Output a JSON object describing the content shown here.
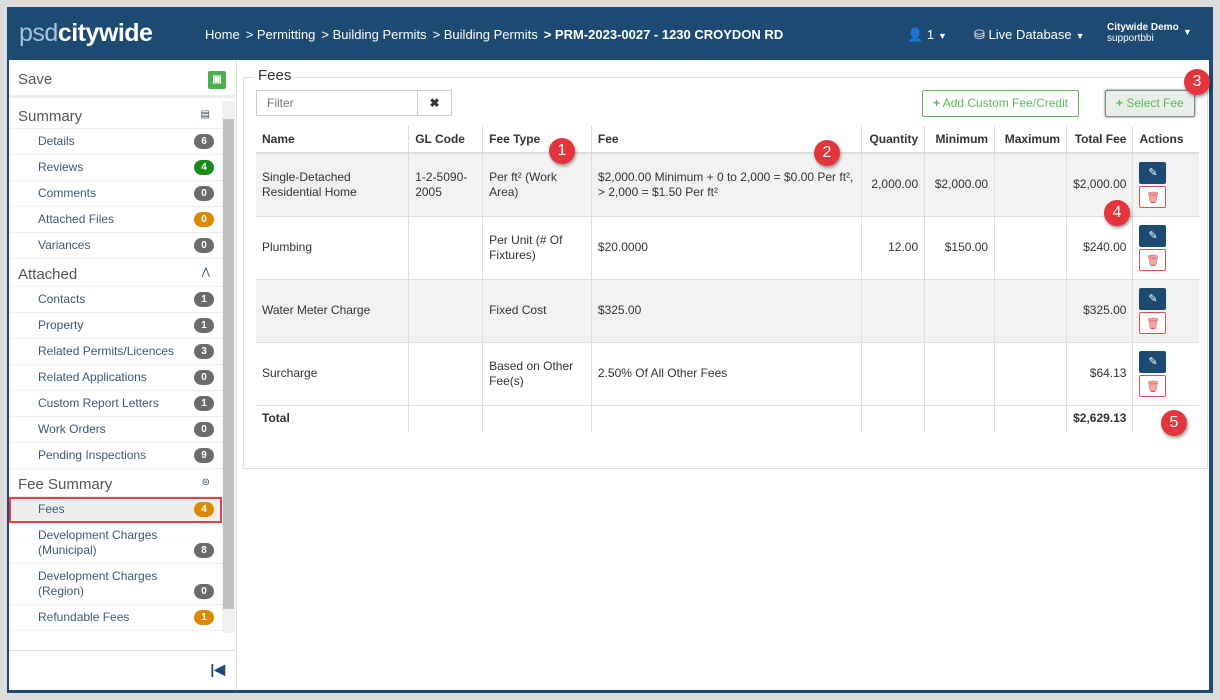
{
  "header": {
    "logo_a": "psd",
    "logo_b": "citywide",
    "breadcrumb": [
      "Home",
      "> Permitting",
      "> Building Permits",
      "> Building Permits",
      "> PRM-2023-0027 - 1230 CROYDON RD"
    ],
    "users": "1",
    "database": "Live Database",
    "user_name": "Citywide Demo",
    "user_id": "supportbbi"
  },
  "sidebar": {
    "save": "Save",
    "sections": [
      {
        "title": "Summary",
        "items": [
          {
            "label": "Details",
            "count": "6",
            "color": "#6b6b6b"
          },
          {
            "label": "Reviews",
            "count": "4",
            "color": "#1a8a1a"
          },
          {
            "label": "Comments",
            "count": "0",
            "color": "#6b6b6b"
          },
          {
            "label": "Attached Files",
            "count": "0",
            "color": "#d98a00"
          },
          {
            "label": "Variances",
            "count": "0",
            "color": "#6b6b6b"
          }
        ]
      },
      {
        "title": "Attached",
        "items": [
          {
            "label": "Contacts",
            "count": "1",
            "color": "#6b6b6b"
          },
          {
            "label": "Property",
            "count": "1",
            "color": "#6b6b6b"
          },
          {
            "label": "Related Permits/Licences",
            "count": "3",
            "color": "#6b6b6b"
          },
          {
            "label": "Related Applications",
            "count": "0",
            "color": "#6b6b6b"
          },
          {
            "label": "Custom Report Letters",
            "count": "1",
            "color": "#6b6b6b"
          },
          {
            "label": "Work Orders",
            "count": "0",
            "color": "#6b6b6b"
          },
          {
            "label": "Pending Inspections",
            "count": "9",
            "color": "#6b6b6b"
          }
        ]
      },
      {
        "title": "Fee Summary",
        "items": [
          {
            "label": "Fees",
            "count": "4",
            "color": "#d98a00",
            "active": true
          },
          {
            "label": "Development Charges (Municipal)",
            "count": "8",
            "color": "#6b6b6b"
          },
          {
            "label": "Development Charges (Region)",
            "count": "0",
            "color": "#6b6b6b"
          },
          {
            "label": "Refundable Fees",
            "count": "1",
            "color": "#d98a00"
          }
        ]
      }
    ]
  },
  "fees": {
    "title": "Fees",
    "filter_placeholder": "Filter",
    "add_custom": "Add Custom Fee/Credit",
    "select_fee": "Select Fee",
    "columns": [
      "Name",
      "GL Code",
      "Fee Type",
      "Fee",
      "Quantity",
      "Minimum",
      "Maximum",
      "Total Fee",
      "Actions"
    ],
    "rows": [
      {
        "name": "Single-Detached Residential Home",
        "gl": "1-2-5090-2005",
        "type": "Per ft² (Work Area)",
        "fee": "$2,000.00 Minimum + 0 to 2,000 = $0.00 Per ft², > 2,000 = $1.50 Per ft²",
        "qty": "2,000.00",
        "min": "$2,000.00",
        "max": "",
        "total": "$2,000.00"
      },
      {
        "name": "Plumbing",
        "gl": "",
        "type": "Per Unit (# Of Fixtures)",
        "fee": "$20.0000",
        "qty": "12.00",
        "min": "$150.00",
        "max": "",
        "total": "$240.00"
      },
      {
        "name": "Water Meter Charge",
        "gl": "",
        "type": "Fixed Cost",
        "fee": "$325.00",
        "qty": "",
        "min": "",
        "max": "",
        "total": "$325.00"
      },
      {
        "name": "Surcharge",
        "gl": "",
        "type": "Based on Other Fee(s)",
        "fee": "2.50% Of All Other Fees",
        "qty": "",
        "min": "",
        "max": "",
        "total": "$64.13"
      }
    ],
    "total_label": "Total",
    "total_value": "$2,629.13"
  },
  "callouts": [
    "1",
    "2",
    "3",
    "4",
    "5"
  ]
}
